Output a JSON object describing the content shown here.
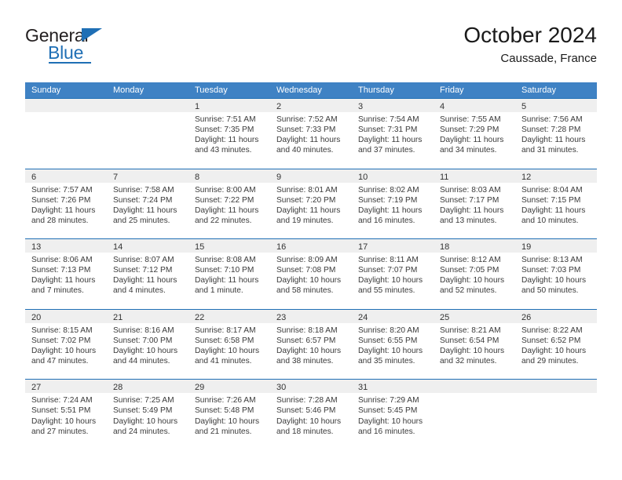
{
  "brand": {
    "name_primary": "General",
    "name_secondary": "Blue",
    "primary_color": "#231f20",
    "accent_color": "#1f6fb5"
  },
  "header": {
    "title": "October 2024",
    "subtitle": "Caussade, France"
  },
  "calendar": {
    "header_bg": "#3f82c4",
    "row_border_color": "#1f6fb5",
    "day_band_bg": "#efefef",
    "weekdays": [
      "Sunday",
      "Monday",
      "Tuesday",
      "Wednesday",
      "Thursday",
      "Friday",
      "Saturday"
    ],
    "weeks": [
      [
        {
          "day": "",
          "empty": true,
          "sunrise": "",
          "sunset": "",
          "daylight_1": "",
          "daylight_2": ""
        },
        {
          "day": "",
          "empty": true,
          "sunrise": "",
          "sunset": "",
          "daylight_1": "",
          "daylight_2": ""
        },
        {
          "day": "1",
          "sunrise": "Sunrise: 7:51 AM",
          "sunset": "Sunset: 7:35 PM",
          "daylight_1": "Daylight: 11 hours",
          "daylight_2": "and 43 minutes."
        },
        {
          "day": "2",
          "sunrise": "Sunrise: 7:52 AM",
          "sunset": "Sunset: 7:33 PM",
          "daylight_1": "Daylight: 11 hours",
          "daylight_2": "and 40 minutes."
        },
        {
          "day": "3",
          "sunrise": "Sunrise: 7:54 AM",
          "sunset": "Sunset: 7:31 PM",
          "daylight_1": "Daylight: 11 hours",
          "daylight_2": "and 37 minutes."
        },
        {
          "day": "4",
          "sunrise": "Sunrise: 7:55 AM",
          "sunset": "Sunset: 7:29 PM",
          "daylight_1": "Daylight: 11 hours",
          "daylight_2": "and 34 minutes."
        },
        {
          "day": "5",
          "sunrise": "Sunrise: 7:56 AM",
          "sunset": "Sunset: 7:28 PM",
          "daylight_1": "Daylight: 11 hours",
          "daylight_2": "and 31 minutes."
        }
      ],
      [
        {
          "day": "6",
          "sunrise": "Sunrise: 7:57 AM",
          "sunset": "Sunset: 7:26 PM",
          "daylight_1": "Daylight: 11 hours",
          "daylight_2": "and 28 minutes."
        },
        {
          "day": "7",
          "sunrise": "Sunrise: 7:58 AM",
          "sunset": "Sunset: 7:24 PM",
          "daylight_1": "Daylight: 11 hours",
          "daylight_2": "and 25 minutes."
        },
        {
          "day": "8",
          "sunrise": "Sunrise: 8:00 AM",
          "sunset": "Sunset: 7:22 PM",
          "daylight_1": "Daylight: 11 hours",
          "daylight_2": "and 22 minutes."
        },
        {
          "day": "9",
          "sunrise": "Sunrise: 8:01 AM",
          "sunset": "Sunset: 7:20 PM",
          "daylight_1": "Daylight: 11 hours",
          "daylight_2": "and 19 minutes."
        },
        {
          "day": "10",
          "sunrise": "Sunrise: 8:02 AM",
          "sunset": "Sunset: 7:19 PM",
          "daylight_1": "Daylight: 11 hours",
          "daylight_2": "and 16 minutes."
        },
        {
          "day": "11",
          "sunrise": "Sunrise: 8:03 AM",
          "sunset": "Sunset: 7:17 PM",
          "daylight_1": "Daylight: 11 hours",
          "daylight_2": "and 13 minutes."
        },
        {
          "day": "12",
          "sunrise": "Sunrise: 8:04 AM",
          "sunset": "Sunset: 7:15 PM",
          "daylight_1": "Daylight: 11 hours",
          "daylight_2": "and 10 minutes."
        }
      ],
      [
        {
          "day": "13",
          "sunrise": "Sunrise: 8:06 AM",
          "sunset": "Sunset: 7:13 PM",
          "daylight_1": "Daylight: 11 hours",
          "daylight_2": "and 7 minutes."
        },
        {
          "day": "14",
          "sunrise": "Sunrise: 8:07 AM",
          "sunset": "Sunset: 7:12 PM",
          "daylight_1": "Daylight: 11 hours",
          "daylight_2": "and 4 minutes."
        },
        {
          "day": "15",
          "sunrise": "Sunrise: 8:08 AM",
          "sunset": "Sunset: 7:10 PM",
          "daylight_1": "Daylight: 11 hours",
          "daylight_2": "and 1 minute."
        },
        {
          "day": "16",
          "sunrise": "Sunrise: 8:09 AM",
          "sunset": "Sunset: 7:08 PM",
          "daylight_1": "Daylight: 10 hours",
          "daylight_2": "and 58 minutes."
        },
        {
          "day": "17",
          "sunrise": "Sunrise: 8:11 AM",
          "sunset": "Sunset: 7:07 PM",
          "daylight_1": "Daylight: 10 hours",
          "daylight_2": "and 55 minutes."
        },
        {
          "day": "18",
          "sunrise": "Sunrise: 8:12 AM",
          "sunset": "Sunset: 7:05 PM",
          "daylight_1": "Daylight: 10 hours",
          "daylight_2": "and 52 minutes."
        },
        {
          "day": "19",
          "sunrise": "Sunrise: 8:13 AM",
          "sunset": "Sunset: 7:03 PM",
          "daylight_1": "Daylight: 10 hours",
          "daylight_2": "and 50 minutes."
        }
      ],
      [
        {
          "day": "20",
          "sunrise": "Sunrise: 8:15 AM",
          "sunset": "Sunset: 7:02 PM",
          "daylight_1": "Daylight: 10 hours",
          "daylight_2": "and 47 minutes."
        },
        {
          "day": "21",
          "sunrise": "Sunrise: 8:16 AM",
          "sunset": "Sunset: 7:00 PM",
          "daylight_1": "Daylight: 10 hours",
          "daylight_2": "and 44 minutes."
        },
        {
          "day": "22",
          "sunrise": "Sunrise: 8:17 AM",
          "sunset": "Sunset: 6:58 PM",
          "daylight_1": "Daylight: 10 hours",
          "daylight_2": "and 41 minutes."
        },
        {
          "day": "23",
          "sunrise": "Sunrise: 8:18 AM",
          "sunset": "Sunset: 6:57 PM",
          "daylight_1": "Daylight: 10 hours",
          "daylight_2": "and 38 minutes."
        },
        {
          "day": "24",
          "sunrise": "Sunrise: 8:20 AM",
          "sunset": "Sunset: 6:55 PM",
          "daylight_1": "Daylight: 10 hours",
          "daylight_2": "and 35 minutes."
        },
        {
          "day": "25",
          "sunrise": "Sunrise: 8:21 AM",
          "sunset": "Sunset: 6:54 PM",
          "daylight_1": "Daylight: 10 hours",
          "daylight_2": "and 32 minutes."
        },
        {
          "day": "26",
          "sunrise": "Sunrise: 8:22 AM",
          "sunset": "Sunset: 6:52 PM",
          "daylight_1": "Daylight: 10 hours",
          "daylight_2": "and 29 minutes."
        }
      ],
      [
        {
          "day": "27",
          "sunrise": "Sunrise: 7:24 AM",
          "sunset": "Sunset: 5:51 PM",
          "daylight_1": "Daylight: 10 hours",
          "daylight_2": "and 27 minutes."
        },
        {
          "day": "28",
          "sunrise": "Sunrise: 7:25 AM",
          "sunset": "Sunset: 5:49 PM",
          "daylight_1": "Daylight: 10 hours",
          "daylight_2": "and 24 minutes."
        },
        {
          "day": "29",
          "sunrise": "Sunrise: 7:26 AM",
          "sunset": "Sunset: 5:48 PM",
          "daylight_1": "Daylight: 10 hours",
          "daylight_2": "and 21 minutes."
        },
        {
          "day": "30",
          "sunrise": "Sunrise: 7:28 AM",
          "sunset": "Sunset: 5:46 PM",
          "daylight_1": "Daylight: 10 hours",
          "daylight_2": "and 18 minutes."
        },
        {
          "day": "31",
          "sunrise": "Sunrise: 7:29 AM",
          "sunset": "Sunset: 5:45 PM",
          "daylight_1": "Daylight: 10 hours",
          "daylight_2": "and 16 minutes."
        },
        {
          "day": "",
          "empty": true,
          "sunrise": "",
          "sunset": "",
          "daylight_1": "",
          "daylight_2": ""
        },
        {
          "day": "",
          "empty": true,
          "sunrise": "",
          "sunset": "",
          "daylight_1": "",
          "daylight_2": ""
        }
      ]
    ]
  }
}
